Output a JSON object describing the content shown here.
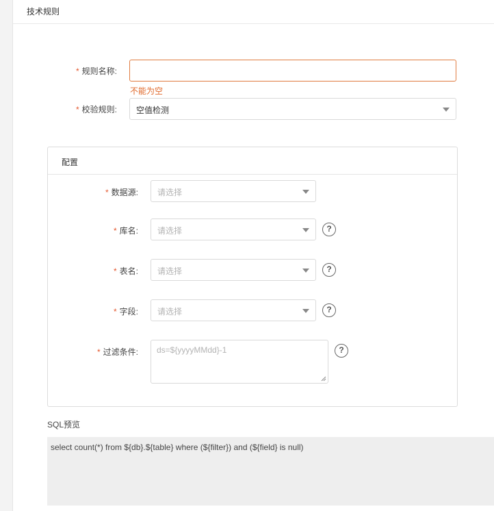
{
  "panel": {
    "title": "技术规则"
  },
  "form": {
    "rule_name": {
      "label": "规则名称:",
      "value": "",
      "error": "不能为空"
    },
    "check_rule": {
      "label": "校验规则:",
      "value": "空值检测"
    }
  },
  "config": {
    "title": "配置",
    "datasource": {
      "label": "数据源:",
      "placeholder": "请选择"
    },
    "database": {
      "label": "库名:",
      "placeholder": "请选择"
    },
    "table": {
      "label": "表名:",
      "placeholder": "请选择"
    },
    "field": {
      "label": "字段:",
      "placeholder": "请选择"
    },
    "filter": {
      "label": "过滤条件:",
      "placeholder": "ds=${yyyyMMdd}-1"
    },
    "help_glyph": "?"
  },
  "sql_preview": {
    "label": "SQL预览",
    "text": "select count(*) from ${db}.${table} where (${filter}) and (${field} is null)"
  },
  "colors": {
    "required": "#e4572e",
    "error": "#e06a2c",
    "error_border": "#e07a3e"
  }
}
